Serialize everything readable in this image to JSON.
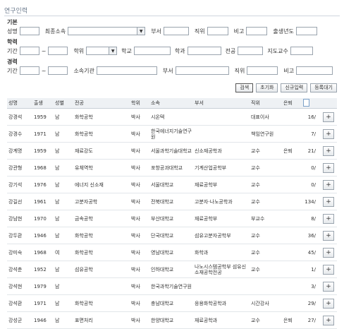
{
  "title": "연구인력",
  "form": {
    "basic_label": "기본",
    "name_label": "성명",
    "affiliation_label": "최종소속",
    "dept_label": "부서",
    "position_label": "직위",
    "note_label": "비고",
    "birth_label": "출생년도",
    "education_label": "학력",
    "period_label": "기간",
    "tilde": "~",
    "degree_label": "학위",
    "school_label": "학교",
    "major_field_label": "학과",
    "specialty_label": "전공",
    "advisor_label": "지도교수",
    "career_label": "경력",
    "org_label": "소속기관",
    "dept2_label": "부서",
    "position2_label": "직위",
    "note2_label": "비고"
  },
  "buttons": {
    "search": "검색",
    "reset": "초기화",
    "new": "신규입력",
    "pending": "등록대기"
  },
  "table": {
    "headers": [
      "성명",
      "출생",
      "성별",
      "전공",
      "학위",
      "소속",
      "부서",
      "직위",
      "은퇴",
      "",
      ""
    ],
    "rows": [
      {
        "name": "강경석",
        "birth": "1959",
        "sex": "남",
        "major": "화학공학",
        "degree": "박사",
        "org": "시온텍",
        "dept": "",
        "pos": "대표이사",
        "retired": "",
        "count": "16/"
      },
      {
        "name": "강경수",
        "birth": "1971",
        "sex": "남",
        "major": "화학공학",
        "degree": "박사",
        "org": "한국에너지기술연구원",
        "dept": "",
        "pos": "책임연구원",
        "retired": "",
        "count": "7/"
      },
      {
        "name": "강계명",
        "birth": "1959",
        "sex": "남",
        "major": "재료강도",
        "degree": "박사",
        "org": "서울과학기술대학교",
        "dept": "신소재공학과",
        "pos": "교수",
        "retired": "은퇴",
        "count": "21/"
      },
      {
        "name": "강관형",
        "birth": "1968",
        "sex": "남",
        "major": "유체역학",
        "degree": "박사",
        "org": "포항공과대학교",
        "dept": "기계산업공학부",
        "pos": "교수",
        "retired": "",
        "count": "0/"
      },
      {
        "name": "강기석",
        "birth": "1976",
        "sex": "남",
        "major": "에너지 신소재",
        "degree": "박사",
        "org": "서울대학교",
        "dept": "재료공학부",
        "pos": "교수",
        "retired": "",
        "count": "0/"
      },
      {
        "name": "강길선",
        "birth": "1961",
        "sex": "남",
        "major": "고분자공학",
        "degree": "박사",
        "org": "전북대학교",
        "dept": "고분자·나노공학과",
        "pos": "교수",
        "retired": "",
        "count": "134/"
      },
      {
        "name": "강남현",
        "birth": "1970",
        "sex": "남",
        "major": "금속공학",
        "degree": "박사",
        "org": "부산대학교",
        "dept": "재료공학부",
        "pos": "부교수",
        "retired": "",
        "count": "8/"
      },
      {
        "name": "강두환",
        "birth": "1946",
        "sex": "남",
        "major": "화학공학",
        "degree": "박사",
        "org": "단국대학교",
        "dept": "섬유고분자공학부",
        "pos": "교수",
        "retired": "",
        "count": "36/"
      },
      {
        "name": "강미숙",
        "birth": "1968",
        "sex": "여",
        "major": "화학공학",
        "degree": "박사",
        "org": "영남대학교",
        "dept": "화학과",
        "pos": "교수",
        "retired": "",
        "count": "45/"
      },
      {
        "name": "강석춘",
        "birth": "1952",
        "sex": "남",
        "major": "섬유공학",
        "degree": "박사",
        "org": "인하대학교",
        "dept": "나노시스템공학부 섬유신소재공학전공",
        "pos": "교수",
        "retired": "",
        "count": "1/"
      },
      {
        "name": "강석현",
        "birth": "1979",
        "sex": "남",
        "major": "",
        "degree": "박사",
        "org": "한국과학기술연구원",
        "dept": "",
        "pos": "",
        "retired": "",
        "count": "3/"
      },
      {
        "name": "강석환",
        "birth": "1971",
        "sex": "남",
        "major": "화학공학",
        "degree": "박사",
        "org": "충남대학교",
        "dept": "응용화학공학과",
        "pos": "시간강사",
        "retired": "",
        "count": "29/"
      },
      {
        "name": "강성군",
        "birth": "1946",
        "sex": "남",
        "major": "표면처리",
        "degree": "박사",
        "org": "한양대학교",
        "dept": "재료공학과",
        "pos": "교수",
        "retired": "은퇴",
        "count": "27/"
      }
    ],
    "plus_label": "+"
  }
}
